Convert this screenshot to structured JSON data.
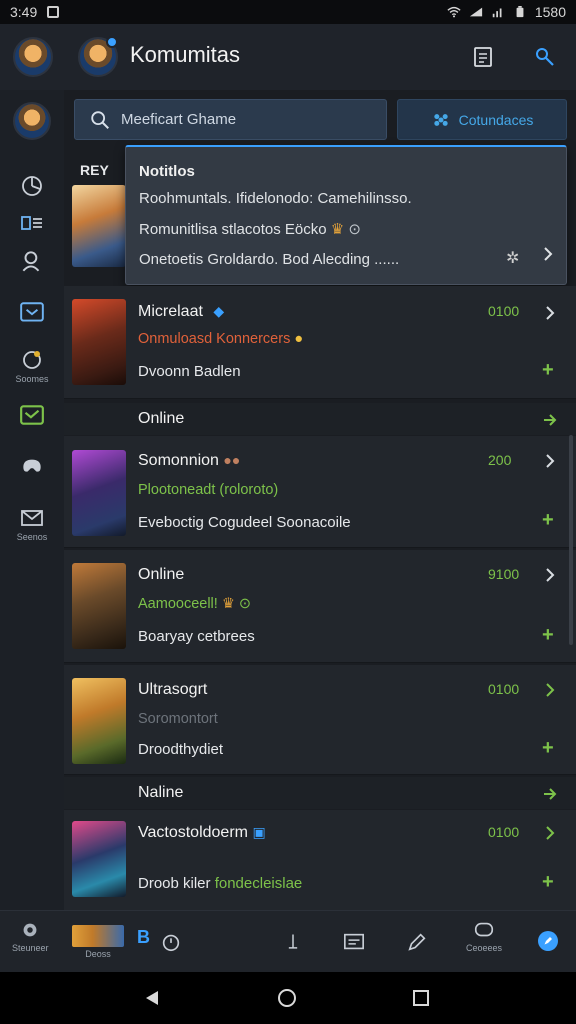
{
  "status_bar": {
    "time": "3:49",
    "right_time": "1580"
  },
  "header": {
    "title": "Komumitas"
  },
  "search": {
    "placeholder": "Meeficart Ghame"
  },
  "category_button": {
    "label": "Cotundaces"
  },
  "hey_label": "REY",
  "notification": {
    "title": "Notitlos",
    "lines": [
      "Roohmuntals. Ifidelonodo: Camehilinsso.",
      "Romunitlisa stlacotos Eöcko",
      "Onetoetis Groldardo. Bod Alecding ......"
    ]
  },
  "rail": {
    "labels": {
      "games": "Soomes",
      "messages": "Seenos"
    }
  },
  "rows": [
    {
      "name": "Micrelaat",
      "count": "0100",
      "sub": "Onmuloasd Konnercers",
      "sub_color": "#e0613a",
      "desc": "Dvoonn Badlen"
    },
    {
      "name": "Somonnion",
      "count": "200",
      "sub": "Plootoneadt (roloroto)",
      "sub_color": "#7dc24a",
      "desc": "Eveboctig Cogudeel Soonacoile"
    },
    {
      "name": "Online",
      "count": "9100",
      "sub": "Aamooceell!",
      "sub_color": "#7dc24a",
      "desc": "Boaryay cetbrees"
    },
    {
      "name": "Ultrasogrt",
      "count": "0100",
      "sub": "Soromontort",
      "sub_color": "#6d737b",
      "desc": "Droodthydiet"
    },
    {
      "name": "Vactostoldoerm",
      "count": "0100",
      "sub": "",
      "sub_color": "#7dc24a",
      "desc": "Droob kiler",
      "desc_green": "fondecleislae"
    }
  ],
  "sections": [
    "Online",
    "Naline"
  ],
  "bottom_nav": {
    "left_label": "Steuneer",
    "center_label": "Deoss",
    "right_label": "Ceoeees",
    "letter": "B"
  },
  "colors": {
    "accent": "#3aa0ff",
    "green": "#7dc24a",
    "orange": "#e0613a"
  },
  "icons": [
    "search-icon",
    "profile-icon",
    "chart-icon",
    "explore-icon",
    "check-icon",
    "star-icon",
    "chevron-right-icon",
    "plus-icon"
  ]
}
